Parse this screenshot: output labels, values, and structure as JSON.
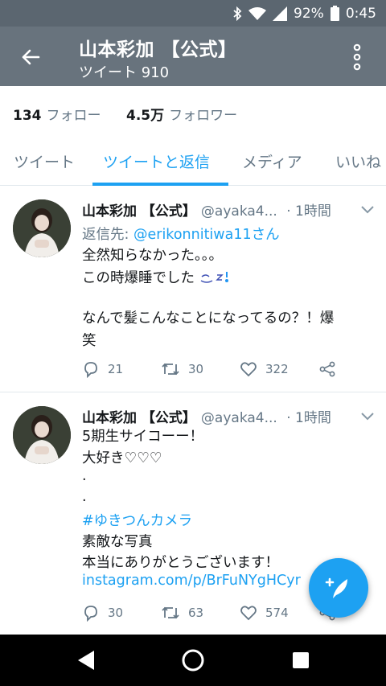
{
  "status_bar": {
    "battery": "92%",
    "time": "0:45",
    "icons": [
      "bluetooth-icon",
      "wifi-icon",
      "cell-signal-icon",
      "battery-icon"
    ]
  },
  "app_bar": {
    "title": "山本彩加 【公式】",
    "subtitle": "ツイート 910"
  },
  "profile": {
    "following_count": "134",
    "following_label": "フォロー",
    "followers_count": "4.5万",
    "followers_label": "フォロワー"
  },
  "tabs": [
    {
      "label": "ツイート"
    },
    {
      "label": "ツイートと返信"
    },
    {
      "label": "メディア"
    },
    {
      "label": "いいね"
    }
  ],
  "active_tab": "ツイートと返信",
  "tweets": [
    {
      "name": "山本彩加 【公式】",
      "handle": "@ayaka4...",
      "time": "· 1時間",
      "reply_to_label": "返信先:",
      "reply_to_user": "@erikonnitiwa11さん",
      "lines": [
        "全然知らなかった。。。",
        "この時爆睡でした",
        "",
        "なんで髪こんなことになってるの？！爆",
        "笑"
      ],
      "replies": "21",
      "retweets": "30",
      "likes": "322"
    },
    {
      "name": "山本彩加 【公式】",
      "handle": "@ayaka4...",
      "time": "· 1時間",
      "lines": [
        "5期生サイコーー！",
        "大好き♡♡♡",
        ".",
        ".",
        "#ゆきつんカメラ",
        "素敵な写真",
        "本当にありがとうございます！",
        "instagram.com/p/BrFuNYgHCyr"
      ],
      "replies": "30",
      "retweets": "63",
      "likes": "574"
    }
  ],
  "colors": {
    "status_bar": "#5b6670",
    "app_bar": "#68737d",
    "accent": "#1da1f2",
    "secondary_text": "#657786"
  }
}
